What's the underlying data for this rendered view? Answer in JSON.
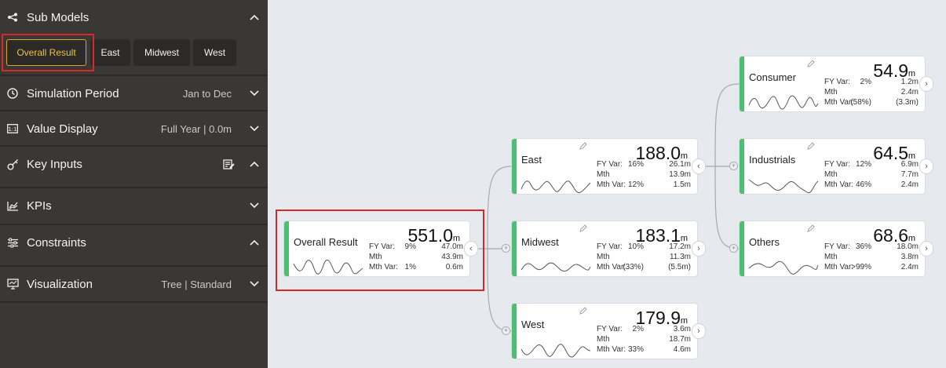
{
  "sidebar": {
    "sub_models": {
      "title": "Sub Models",
      "buttons": [
        "Overall Result",
        "East",
        "Midwest",
        "West"
      ],
      "active": "Overall Result"
    },
    "simulation_period": {
      "title": "Simulation Period",
      "value": "Jan to Dec"
    },
    "value_display": {
      "title": "Value Display",
      "value": "Full Year | 0.0m"
    },
    "key_inputs": {
      "title": "Key Inputs"
    },
    "kpis": {
      "title": "KPIs"
    },
    "constraints": {
      "title": "Constraints"
    },
    "visualization": {
      "title": "Visualization",
      "value": "Tree | Standard"
    }
  },
  "labels": {
    "fy_var": "FY Var:",
    "mth": "Mth",
    "mth_var": "Mth Var:"
  },
  "nodes": {
    "overall": {
      "name": "Overall Result",
      "value": "551.0",
      "unit": "m",
      "fy_var_pct": "9%",
      "fy_var_amt": "47.0m",
      "mth_amt": "43.9m",
      "mth_var_pct": "1%",
      "mth_var_amt": "0.6m"
    },
    "east": {
      "name": "East",
      "value": "188.0",
      "unit": "m",
      "fy_var_pct": "16%",
      "fy_var_amt": "26.1m",
      "mth_amt": "13.9m",
      "mth_var_pct": "12%",
      "mth_var_amt": "1.5m"
    },
    "midwest": {
      "name": "Midwest",
      "value": "183.1",
      "unit": "m",
      "fy_var_pct": "10%",
      "fy_var_amt": "17.2m",
      "mth_amt": "11.3m",
      "mth_var_pct": "(33%)",
      "mth_var_amt": "(5.5m)"
    },
    "west": {
      "name": "West",
      "value": "179.9",
      "unit": "m",
      "fy_var_pct": "2%",
      "fy_var_amt": "3.6m",
      "mth_amt": "18.7m",
      "mth_var_pct": "33%",
      "mth_var_amt": "4.6m"
    },
    "consumer": {
      "name": "Consumer",
      "value": "54.9",
      "unit": "m",
      "fy_var_pct": "2%",
      "fy_var_amt": "1.2m",
      "mth_amt": "2.4m",
      "mth_var_pct": "(58%)",
      "mth_var_amt": "(3.3m)"
    },
    "industrials": {
      "name": "Industrials",
      "value": "64.5",
      "unit": "m",
      "fy_var_pct": "12%",
      "fy_var_amt": "6.9m",
      "mth_amt": "7.7m",
      "mth_var_pct": "46%",
      "mth_var_amt": "2.4m"
    },
    "others": {
      "name": "Others",
      "value": "68.6",
      "unit": "m",
      "fy_var_pct": "36%",
      "fy_var_amt": "18.0m",
      "mth_amt": "3.8m",
      "mth_var_pct": ">99%",
      "mth_var_amt": "2.4m"
    }
  },
  "colors": {
    "sidebar_bg": "#3a3835",
    "canvas_bg": "#e6e9ee",
    "node_accent": "#4cbf73",
    "active_border": "#d9a521",
    "highlight": "#d62a2a"
  }
}
